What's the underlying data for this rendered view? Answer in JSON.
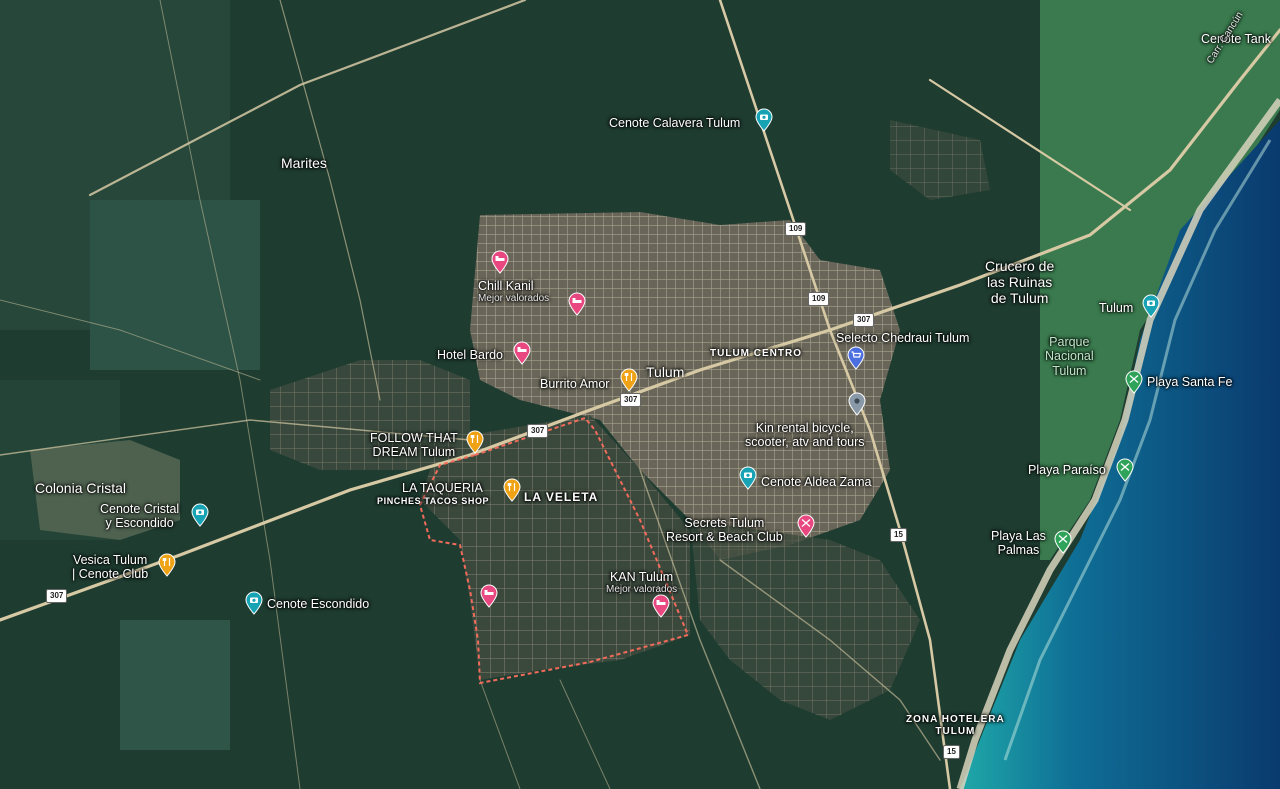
{
  "places": {
    "marites": "Marites",
    "cenote_calavera": "Cenote Calavera Tulum",
    "cenote_tank": "Cenote Tank",
    "carretera": "Carr. Cancún",
    "crucero_1": "Crucero de",
    "crucero_2": "las Ruinas",
    "crucero_3": "de Tulum",
    "chill_kanil": "Chill Kanil",
    "chill_kanil_sub": "Mejor valorados",
    "hotel_bardo": "Hotel Bardo",
    "burrito_amor": "Burrito Amor",
    "tulum": "Tulum",
    "tulum_centro": "TULUM CENTRO",
    "selecto_chedraui": "Selecto Chedraui Tulum",
    "tulum_ruins": "Tulum",
    "parque_1": "Parque",
    "parque_2": "Nacional",
    "parque_3": "Tulum",
    "playa_santa_fe": "Playa Santa Fe",
    "follow_dream_1": "FOLLOW THAT",
    "follow_dream_2": "DREAM Tulum",
    "kin_rental_1": "Kin rental bicycle,",
    "kin_rental_2": "scooter, atv and tours",
    "playa_paraiso": "Playa Paraíso",
    "la_taqueria": "LA TAQUERIA",
    "pinches_tacos": "PINCHES TACOS SHOP",
    "la_veleta": "LA VELETA",
    "cenote_aldea_zama": "Cenote Aldea Zama",
    "colonia_cristal": "Colonia Cristal",
    "cenote_cristal_1": "Cenote Cristal",
    "cenote_cristal_2": "y Escondido",
    "secrets_1": "Secrets Tulum",
    "secrets_2": "Resort & Beach Club",
    "playa_las_palmas_1": "Playa Las",
    "playa_las_palmas_2": "Palmas",
    "vesica_1": "Vesica Tulum",
    "vesica_2": "| Cenote Club",
    "kan_tulum": "KAN Tulum",
    "kan_tulum_sub": "Mejor valorados",
    "cenote_escondido": "Cenote Escondido",
    "zona_hotelera_1": "ZONA HOTELERA",
    "zona_hotelera_2": "TULUM"
  },
  "shields": {
    "r109_a": "109",
    "r109_b": "109",
    "r307_a": "307",
    "r307_b": "307",
    "r307_c": "307",
    "r307_d": "307",
    "r15_a": "15",
    "r15_b": "15"
  },
  "colors": {
    "hotel_pin": "#e8477f",
    "restaurant_pin": "#f0a215",
    "photo_pin": "#17a3b3",
    "shopping_pin": "#4c6fe0",
    "generic_pin": "#8a99a8",
    "park_pin": "#2fa35a",
    "boundary": "#f26b5b"
  }
}
